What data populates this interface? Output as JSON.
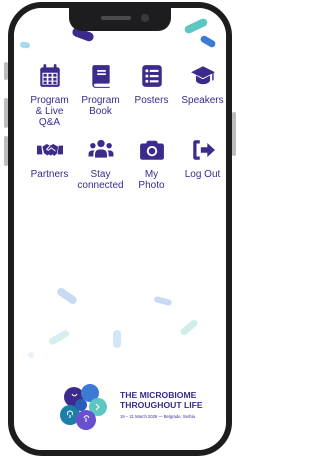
{
  "colors": {
    "accent": "#3d2a8c",
    "teal": "#5cc6c0",
    "blue": "#3a7bd5",
    "frame": "#1d1d1f"
  },
  "menu": [
    {
      "label": "Program\n& Live\nQ&A",
      "icon": "calendar-icon"
    },
    {
      "label": "Program\nBook",
      "icon": "book-icon"
    },
    {
      "label": "Posters",
      "icon": "list-icon"
    },
    {
      "label": "Speakers",
      "icon": "graduation-cap-icon"
    },
    {
      "label": "Partners",
      "icon": "handshake-icon"
    },
    {
      "label": "Stay\nconnected",
      "icon": "users-icon"
    },
    {
      "label": "My\nPhoto",
      "icon": "camera-icon"
    },
    {
      "label": "Log Out",
      "icon": "sign-out-icon"
    }
  ],
  "event_logo": {
    "title": "THE MICROBIOME\nTHROUGHOUT LIFE",
    "subtitle": "19 – 21 March 2026 — Belgrade, Serbia"
  }
}
